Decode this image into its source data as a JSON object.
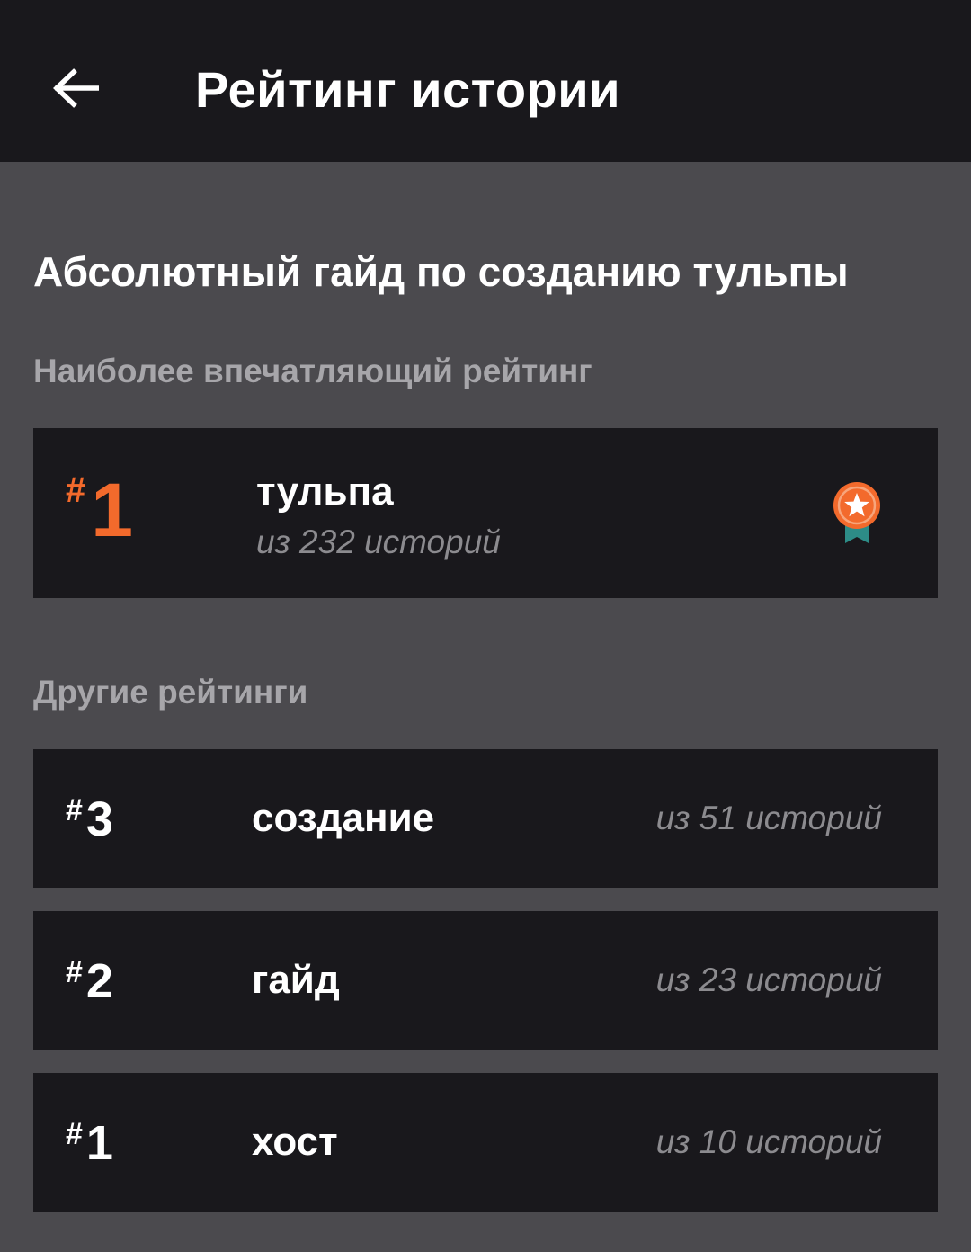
{
  "header": {
    "title": "Рейтинг истории",
    "back_icon": "arrow-left-icon"
  },
  "story": {
    "title": "Абсолютный гайд по созданию тульпы"
  },
  "featured_section": {
    "heading": "Наиболее впечатляющий рейтинг",
    "item": {
      "hash": "#",
      "rank": "1",
      "tag": "тульпа",
      "count": "из 232 историй",
      "badge_icon": "medal-star-icon"
    }
  },
  "other_section": {
    "heading": "Другие рейтинги",
    "items": [
      {
        "hash": "#",
        "rank": "3",
        "tag": "создание",
        "count": "из 51 историй"
      },
      {
        "hash": "#",
        "rank": "2",
        "tag": "гайд",
        "count": "из 23 историй"
      },
      {
        "hash": "#",
        "rank": "1",
        "tag": "хост",
        "count": "из 10 историй"
      }
    ]
  },
  "colors": {
    "header_bg": "#19181c",
    "page_bg": "#4b4a4e",
    "card_bg": "#19181c",
    "accent_orange": "#f36a2c",
    "ribbon_teal": "#2d8c87",
    "muted_text": "#8c8b8f",
    "section_heading": "#a7a6aa"
  }
}
